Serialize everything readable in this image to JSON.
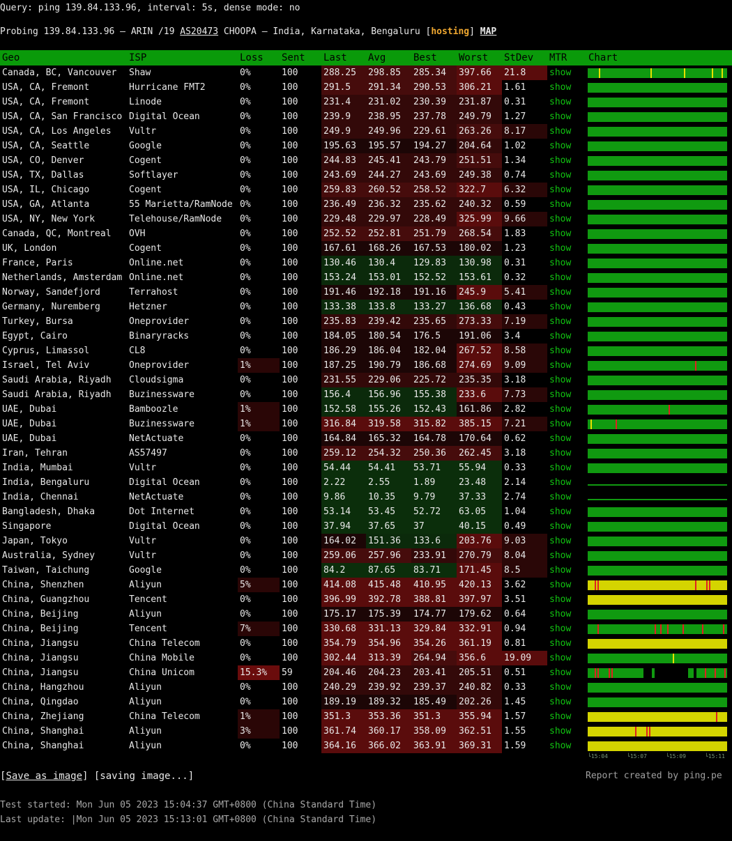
{
  "query": {
    "text": "Query: ping 139.84.133.96, interval: 5s, dense mode: no"
  },
  "probe": {
    "prefix": "Probing 139.84.133.96 — ARIN /19 ",
    "asn": "AS20473",
    "middle": " CHOOPA — India, Karnataka, Bengaluru [",
    "hosting": "hosting",
    "close": "] ",
    "map": "MAP"
  },
  "headers": [
    "Geo",
    "ISP",
    "Loss",
    "Sent",
    "Last",
    "Avg",
    "Best",
    "Worst",
    "StDev",
    "MTR",
    "Chart"
  ],
  "mtr_label": "show",
  "colors": {
    "header_green": "#0a9a0a",
    "chart_green": "#109a10",
    "chart_yellow": "#d4d400",
    "red_event": "#e02020",
    "yellow_event": "#e8e000"
  },
  "rows": [
    {
      "geo": "Canada, BC, Vancouver",
      "isp": "Shaw",
      "loss": "0%",
      "sent": "100",
      "last": "288.25",
      "avg": "298.85",
      "best": "285.34",
      "worst": "397.66",
      "stdev": "21.8"
    },
    {
      "geo": "USA, CA, Fremont",
      "isp": "Hurricane FMT2",
      "loss": "0%",
      "sent": "100",
      "last": "291.5",
      "avg": "291.34",
      "best": "290.53",
      "worst": "306.21",
      "stdev": "1.61"
    },
    {
      "geo": "USA, CA, Fremont",
      "isp": "Linode",
      "loss": "0%",
      "sent": "100",
      "last": "231.4",
      "avg": "231.02",
      "best": "230.39",
      "worst": "231.87",
      "stdev": "0.31"
    },
    {
      "geo": "USA, CA, San Francisco",
      "isp": "Digital Ocean",
      "loss": "0%",
      "sent": "100",
      "last": "239.9",
      "avg": "238.95",
      "best": "237.78",
      "worst": "249.79",
      "stdev": "1.27"
    },
    {
      "geo": "USA, CA, Los Angeles",
      "isp": "Vultr",
      "loss": "0%",
      "sent": "100",
      "last": "249.9",
      "avg": "249.96",
      "best": "229.61",
      "worst": "263.26",
      "stdev": "8.17"
    },
    {
      "geo": "USA, CA, Seattle",
      "isp": "Google",
      "loss": "0%",
      "sent": "100",
      "last": "195.63",
      "avg": "195.57",
      "best": "194.27",
      "worst": "204.64",
      "stdev": "1.02"
    },
    {
      "geo": "USA, CO, Denver",
      "isp": "Cogent",
      "loss": "0%",
      "sent": "100",
      "last": "244.83",
      "avg": "245.41",
      "best": "243.79",
      "worst": "251.51",
      "stdev": "1.34"
    },
    {
      "geo": "USA, TX, Dallas",
      "isp": "Softlayer",
      "loss": "0%",
      "sent": "100",
      "last": "243.69",
      "avg": "244.27",
      "best": "243.69",
      "worst": "249.38",
      "stdev": "0.74"
    },
    {
      "geo": "USA, IL, Chicago",
      "isp": "Cogent",
      "loss": "0%",
      "sent": "100",
      "last": "259.83",
      "avg": "260.52",
      "best": "258.52",
      "worst": "322.7",
      "stdev": "6.32"
    },
    {
      "geo": "USA, GA, Atlanta",
      "isp": "55 Marietta/RamNode",
      "loss": "0%",
      "sent": "100",
      "last": "236.49",
      "avg": "236.32",
      "best": "235.62",
      "worst": "240.32",
      "stdev": "0.59"
    },
    {
      "geo": "USA, NY, New York",
      "isp": "Telehouse/RamNode",
      "loss": "0%",
      "sent": "100",
      "last": "229.48",
      "avg": "229.97",
      "best": "228.49",
      "worst": "325.99",
      "stdev": "9.66"
    },
    {
      "geo": "Canada, QC, Montreal",
      "isp": "OVH",
      "loss": "0%",
      "sent": "100",
      "last": "252.52",
      "avg": "252.81",
      "best": "251.79",
      "worst": "268.54",
      "stdev": "1.83"
    },
    {
      "geo": "UK, London",
      "isp": "Cogent",
      "loss": "0%",
      "sent": "100",
      "last": "167.61",
      "avg": "168.26",
      "best": "167.53",
      "worst": "180.02",
      "stdev": "1.23"
    },
    {
      "geo": "France, Paris",
      "isp": "Online.net",
      "loss": "0%",
      "sent": "100",
      "last": "130.46",
      "avg": "130.4",
      "best": "129.83",
      "worst": "130.98",
      "stdev": "0.31"
    },
    {
      "geo": "Netherlands, Amsterdam",
      "isp": "Online.net",
      "loss": "0%",
      "sent": "100",
      "last": "153.24",
      "avg": "153.01",
      "best": "152.52",
      "worst": "153.61",
      "stdev": "0.32"
    },
    {
      "geo": "Norway, Sandefjord",
      "isp": "Terrahost",
      "loss": "0%",
      "sent": "100",
      "last": "191.46",
      "avg": "192.18",
      "best": "191.16",
      "worst": "245.9",
      "stdev": "5.41"
    },
    {
      "geo": "Germany, Nuremberg",
      "isp": "Hetzner",
      "loss": "0%",
      "sent": "100",
      "last": "133.38",
      "avg": "133.8",
      "best": "133.27",
      "worst": "136.68",
      "stdev": "0.43"
    },
    {
      "geo": "Turkey, Bursa",
      "isp": "Oneprovider",
      "loss": "0%",
      "sent": "100",
      "last": "235.83",
      "avg": "239.42",
      "best": "235.65",
      "worst": "273.33",
      "stdev": "7.19"
    },
    {
      "geo": "Egypt, Cairo",
      "isp": "Binaryracks",
      "loss": "0%",
      "sent": "100",
      "last": "184.05",
      "avg": "180.54",
      "best": "176.5",
      "worst": "191.06",
      "stdev": "3.4"
    },
    {
      "geo": "Cyprus, Limassol",
      "isp": "CL8",
      "loss": "0%",
      "sent": "100",
      "last": "186.29",
      "avg": "186.04",
      "best": "182.04",
      "worst": "267.52",
      "stdev": "8.58"
    },
    {
      "geo": "Israel, Tel Aviv",
      "isp": "Oneprovider",
      "loss": "1%",
      "sent": "100",
      "last": "187.25",
      "avg": "190.79",
      "best": "186.68",
      "worst": "274.69",
      "stdev": "9.09"
    },
    {
      "geo": "Saudi Arabia, Riyadh",
      "isp": "Cloudsigma",
      "loss": "0%",
      "sent": "100",
      "last": "231.55",
      "avg": "229.06",
      "best": "225.72",
      "worst": "235.35",
      "stdev": "3.18"
    },
    {
      "geo": "Saudi Arabia, Riyadh",
      "isp": "Buzinessware",
      "loss": "0%",
      "sent": "100",
      "last": "156.4",
      "avg": "156.96",
      "best": "155.38",
      "worst": "233.6",
      "stdev": "7.73"
    },
    {
      "geo": "UAE, Dubai",
      "isp": "Bamboozle",
      "loss": "1%",
      "sent": "100",
      "last": "152.58",
      "avg": "155.26",
      "best": "152.43",
      "worst": "161.86",
      "stdev": "2.82"
    },
    {
      "geo": "UAE, Dubai",
      "isp": "Buzinessware",
      "loss": "1%",
      "sent": "100",
      "last": "316.84",
      "avg": "319.58",
      "best": "315.82",
      "worst": "385.15",
      "stdev": "7.21"
    },
    {
      "geo": "UAE, Dubai",
      "isp": "NetActuate",
      "loss": "0%",
      "sent": "100",
      "last": "164.84",
      "avg": "165.32",
      "best": "164.78",
      "worst": "170.64",
      "stdev": "0.62"
    },
    {
      "geo": "Iran, Tehran",
      "isp": "AS57497",
      "loss": "0%",
      "sent": "100",
      "last": "259.12",
      "avg": "254.32",
      "best": "250.36",
      "worst": "262.45",
      "stdev": "3.18"
    },
    {
      "geo": "India, Mumbai",
      "isp": "Vultr",
      "loss": "0%",
      "sent": "100",
      "last": "54.44",
      "avg": "54.41",
      "best": "53.71",
      "worst": "55.94",
      "stdev": "0.33"
    },
    {
      "geo": "India, Bengaluru",
      "isp": "Digital Ocean",
      "loss": "0%",
      "sent": "100",
      "last": "2.22",
      "avg": "2.55",
      "best": "1.89",
      "worst": "23.48",
      "stdev": "2.14"
    },
    {
      "geo": "India, Chennai",
      "isp": "NetActuate",
      "loss": "0%",
      "sent": "100",
      "last": "9.86",
      "avg": "10.35",
      "best": "9.79",
      "worst": "37.33",
      "stdev": "2.74"
    },
    {
      "geo": "Bangladesh, Dhaka",
      "isp": "Dot Internet",
      "loss": "0%",
      "sent": "100",
      "last": "53.14",
      "avg": "53.45",
      "best": "52.72",
      "worst": "63.05",
      "stdev": "1.04"
    },
    {
      "geo": "Singapore",
      "isp": "Digital Ocean",
      "loss": "0%",
      "sent": "100",
      "last": "37.94",
      "avg": "37.65",
      "best": "37",
      "worst": "40.15",
      "stdev": "0.49"
    },
    {
      "geo": "Japan, Tokyo",
      "isp": "Vultr",
      "loss": "0%",
      "sent": "100",
      "last": "164.02",
      "avg": "151.36",
      "best": "133.6",
      "worst": "203.76",
      "stdev": "9.03"
    },
    {
      "geo": "Australia, Sydney",
      "isp": "Vultr",
      "loss": "0%",
      "sent": "100",
      "last": "259.06",
      "avg": "257.96",
      "best": "233.91",
      "worst": "270.79",
      "stdev": "8.04"
    },
    {
      "geo": "Taiwan, Taichung",
      "isp": "Google",
      "loss": "0%",
      "sent": "100",
      "last": "84.2",
      "avg": "87.65",
      "best": "83.71",
      "worst": "171.45",
      "stdev": "8.5"
    },
    {
      "geo": "China, Shenzhen",
      "isp": "Aliyun",
      "loss": "5%",
      "sent": "100",
      "last": "414.08",
      "avg": "415.48",
      "best": "410.95",
      "worst": "420.13",
      "stdev": "3.62"
    },
    {
      "geo": "China, Guangzhou",
      "isp": "Tencent",
      "loss": "0%",
      "sent": "100",
      "last": "396.99",
      "avg": "392.78",
      "best": "388.81",
      "worst": "397.97",
      "stdev": "3.51"
    },
    {
      "geo": "China, Beijing",
      "isp": "Aliyun",
      "loss": "0%",
      "sent": "100",
      "last": "175.17",
      "avg": "175.39",
      "best": "174.77",
      "worst": "179.62",
      "stdev": "0.64"
    },
    {
      "geo": "China, Beijing",
      "isp": "Tencent",
      "loss": "7%",
      "sent": "100",
      "last": "330.68",
      "avg": "331.13",
      "best": "329.84",
      "worst": "332.91",
      "stdev": "0.94"
    },
    {
      "geo": "China, Jiangsu",
      "isp": "China Telecom",
      "loss": "0%",
      "sent": "100",
      "last": "354.79",
      "avg": "354.96",
      "best": "354.26",
      "worst": "361.19",
      "stdev": "0.81"
    },
    {
      "geo": "China, Jiangsu",
      "isp": "China Mobile",
      "loss": "0%",
      "sent": "100",
      "last": "302.44",
      "avg": "313.39",
      "best": "264.94",
      "worst": "356.6",
      "stdev": "19.09"
    },
    {
      "geo": "China, Jiangsu",
      "isp": "China Unicom",
      "loss": "15.3%",
      "sent": "59",
      "last": "204.46",
      "avg": "204.23",
      "best": "203.41",
      "worst": "205.51",
      "stdev": "0.51"
    },
    {
      "geo": "China, Hangzhou",
      "isp": "Aliyun",
      "loss": "0%",
      "sent": "100",
      "last": "240.29",
      "avg": "239.92",
      "best": "239.37",
      "worst": "240.82",
      "stdev": "0.33"
    },
    {
      "geo": "China, Qingdao",
      "isp": "Aliyun",
      "loss": "0%",
      "sent": "100",
      "last": "189.19",
      "avg": "189.32",
      "best": "185.49",
      "worst": "202.26",
      "stdev": "1.45"
    },
    {
      "geo": "China, Zhejiang",
      "isp": "China Telecom",
      "loss": "1%",
      "sent": "100",
      "last": "351.3",
      "avg": "353.36",
      "best": "351.3",
      "worst": "355.94",
      "stdev": "1.57"
    },
    {
      "geo": "China, Shanghai",
      "isp": "Aliyun",
      "loss": "3%",
      "sent": "100",
      "last": "361.74",
      "avg": "360.17",
      "best": "358.09",
      "worst": "362.51",
      "stdev": "1.55"
    },
    {
      "geo": "China, Shanghai",
      "isp": "Aliyun",
      "loss": "0%",
      "sent": "100",
      "last": "364.16",
      "avg": "366.02",
      "best": "363.91",
      "worst": "369.31",
      "stdev": "1.59"
    }
  ],
  "chart_axis": [
    "15:04",
    "15:07",
    "15:09",
    "15:11"
  ],
  "footer": {
    "save_open": "[",
    "save_label": "Save as image",
    "save_close": "] [saving image...]",
    "report": "Report created by ping.pe",
    "started": "Test started: Mon Jun 05 2023 15:04:37 GMT+0800 (China Standard Time)",
    "updated": "Last update: |Mon Jun 05 2023 15:13:01 GMT+0800 (China Standard Time)"
  }
}
